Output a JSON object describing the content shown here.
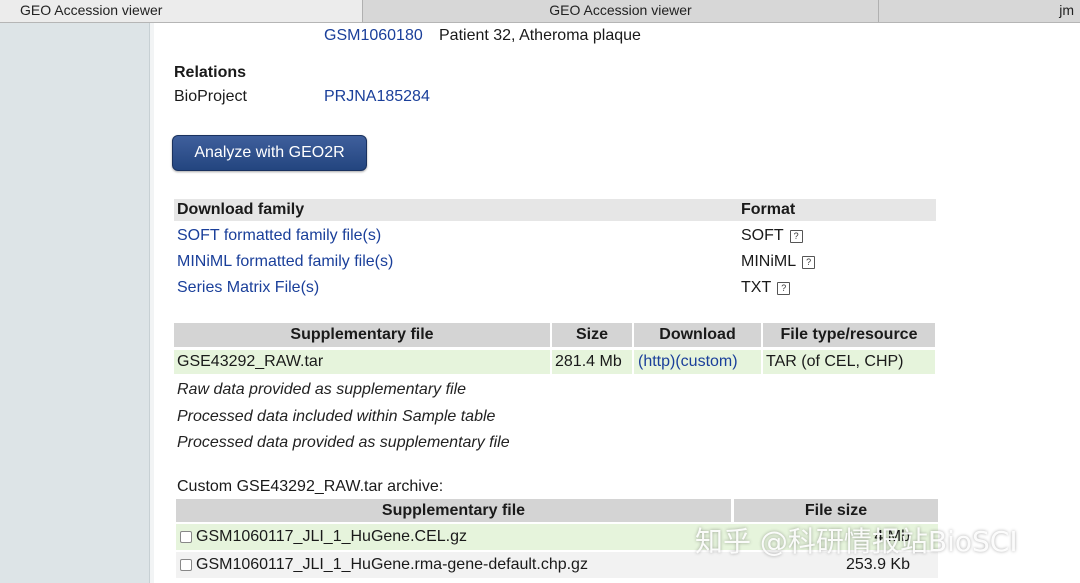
{
  "browser": {
    "tabs": [
      {
        "label": "GEO Accession viewer"
      },
      {
        "label": "GEO Accession viewer"
      },
      {
        "label": "jm"
      }
    ]
  },
  "samples": {
    "last_id": "GSM1060180",
    "last_desc": "Patient 32, Atheroma plaque"
  },
  "relations": {
    "heading": "Relations",
    "bioproject_label": "BioProject",
    "bioproject_id": "PRJNA185284"
  },
  "analyze_button": "Analyze with GEO2R",
  "download_family": {
    "col_family": "Download family",
    "col_format": "Format",
    "rows": [
      {
        "label": "SOFT formatted family file(s)",
        "format": "SOFT"
      },
      {
        "label": "MINiML formatted family file(s)",
        "format": "MINiML"
      },
      {
        "label": "Series Matrix File(s)",
        "format": "TXT"
      }
    ],
    "help_glyph": "?"
  },
  "supplementary": {
    "headers": [
      "Supplementary file",
      "Size",
      "Download",
      "File type/resource"
    ],
    "row": {
      "file": "GSE43292_RAW.tar",
      "size": "281.4 Mb",
      "http": "(http)",
      "custom": "(custom)",
      "type": "TAR (of CEL, CHP)"
    },
    "notes": [
      "Raw data provided as supplementary file",
      "Processed data included within Sample table",
      "Processed data provided as supplementary file"
    ]
  },
  "custom_archive": {
    "title": "Custom GSE43292_RAW.tar archive:",
    "headers": [
      "Supplementary file",
      "File size"
    ],
    "rows": [
      {
        "file": "GSM1060117_JLI_1_HuGene.CEL.gz",
        "size": "4 Mb"
      },
      {
        "file": "GSM1060117_JLI_1_HuGene.rma-gene-default.chp.gz",
        "size": "253.9 Kb"
      }
    ]
  },
  "watermark": "知乎 @科研情报站BioSCI"
}
